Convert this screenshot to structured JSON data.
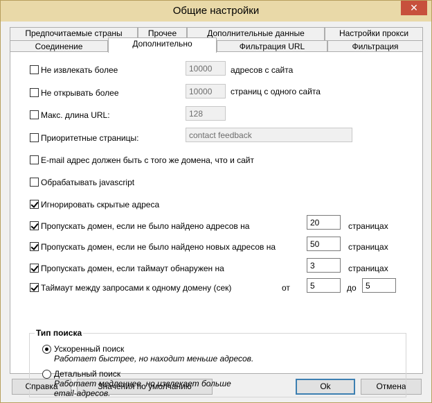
{
  "window": {
    "title": "Общие настройки",
    "close_glyph": "✕"
  },
  "tabs_row1": [
    {
      "label": "Предпочитаемые страны"
    },
    {
      "label": "Прочее"
    },
    {
      "label": "Дополнительные данные"
    },
    {
      "label": "Настройки прокси"
    }
  ],
  "tabs_row2": [
    {
      "label": "Соединение"
    },
    {
      "label": "Дополнительно",
      "active": true
    },
    {
      "label": "Фильтрация URL"
    },
    {
      "label": "Фильтрация"
    }
  ],
  "options": {
    "max_addresses": {
      "label": "Не извлекать более",
      "checked": false,
      "value": "10000",
      "suffix": "адресов с сайта"
    },
    "max_pages": {
      "label": "Не открывать более",
      "checked": false,
      "value": "10000",
      "suffix": "страниц с одного сайта"
    },
    "max_url_len": {
      "label": "Макс. длина URL:",
      "checked": false,
      "value": "128"
    },
    "priority_pages": {
      "label": "Приоритетные страницы:",
      "checked": false,
      "value": "contact feedback"
    },
    "same_domain_email": {
      "label": "E-mail адрес должен быть с того же домена, что и сайт",
      "checked": false
    },
    "process_js": {
      "label": "Обрабатывать javascript",
      "checked": false
    },
    "ignore_hidden": {
      "label": "Игнорировать скрытые адреса",
      "checked": true
    },
    "skip_no_addresses": {
      "label": "Пропускать домен, если не было найдено адресов на",
      "checked": true,
      "value": "20",
      "suffix": "страницах"
    },
    "skip_no_new": {
      "label": "Пропускать домен, если не было найдено новых адресов на",
      "checked": true,
      "value": "50",
      "suffix": "страницах"
    },
    "skip_timeout": {
      "label": "Пропускать домен, если таймаут обнаружен на",
      "checked": true,
      "value": "3",
      "suffix": "страницах"
    },
    "request_delay": {
      "label": "Таймаут между запросами к одному домену (сек)",
      "checked": true,
      "from_label": "от",
      "from_value": "5",
      "to_label": "до",
      "to_value": "5"
    }
  },
  "search_type": {
    "title": "Тип поиска",
    "fast": {
      "label": "Ускоренный поиск",
      "desc": "Работает быстрее, но находит меньше адресов.",
      "selected": true
    },
    "detailed": {
      "label": "Детальный поиск",
      "desc_line1": "Работает медленнее, но извлекает больше",
      "desc_line2": "email-адресов.",
      "selected": false
    }
  },
  "buttons": {
    "help": "Справка",
    "defaults": "Значения по умолчанию",
    "ok": "Ok",
    "cancel": "Отмена"
  }
}
